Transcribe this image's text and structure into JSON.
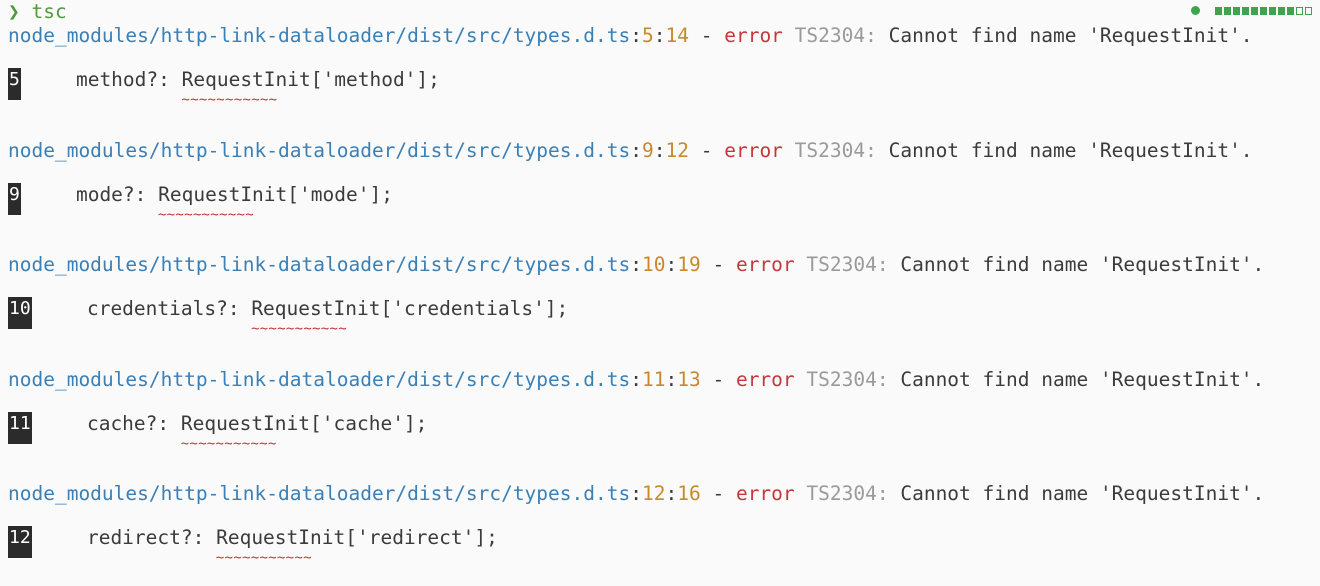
{
  "prompt": {
    "arrow": "❯",
    "command": "tsc"
  },
  "status": {
    "progress_filled": 9,
    "progress_total": 11
  },
  "errors": [
    {
      "path": "node_modules/http-link-dataloader/dist/src/types.d.ts",
      "line": "5",
      "col": "14",
      "dash": "-",
      "severity": "error",
      "code": "TS2304:",
      "message": "Cannot find name 'RequestInit'.",
      "gutter": "5",
      "source": "    method?: RequestInit['method'];",
      "squiggle": "~~~~~~~~~~~"
    },
    {
      "path": "node_modules/http-link-dataloader/dist/src/types.d.ts",
      "line": "9",
      "col": "12",
      "dash": "-",
      "severity": "error",
      "code": "TS2304:",
      "message": "Cannot find name 'RequestInit'.",
      "gutter": "9",
      "source": "    mode?: RequestInit['mode'];",
      "squiggle": "~~~~~~~~~~~"
    },
    {
      "path": "node_modules/http-link-dataloader/dist/src/types.d.ts",
      "line": "10",
      "col": "19",
      "dash": "-",
      "severity": "error",
      "code": "TS2304:",
      "message": "Cannot find name 'RequestInit'.",
      "gutter": "10",
      "source": "    credentials?: RequestInit['credentials'];",
      "squiggle": "~~~~~~~~~~~"
    },
    {
      "path": "node_modules/http-link-dataloader/dist/src/types.d.ts",
      "line": "11",
      "col": "13",
      "dash": "-",
      "severity": "error",
      "code": "TS2304:",
      "message": "Cannot find name 'RequestInit'.",
      "gutter": "11",
      "source": "    cache?: RequestInit['cache'];",
      "squiggle": "~~~~~~~~~~~"
    },
    {
      "path": "node_modules/http-link-dataloader/dist/src/types.d.ts",
      "line": "12",
      "col": "16",
      "dash": "-",
      "severity": "error",
      "code": "TS2304:",
      "message": "Cannot find name 'RequestInit'.",
      "gutter": "12",
      "source": "    redirect?: RequestInit['redirect'];",
      "squiggle": "~~~~~~~~~~~"
    }
  ],
  "colors": {
    "path": "#3b7fb5",
    "location": "#c8892d",
    "error": "#c6363a",
    "prompt": "#4f9a3c",
    "status": "#3fa34d"
  }
}
